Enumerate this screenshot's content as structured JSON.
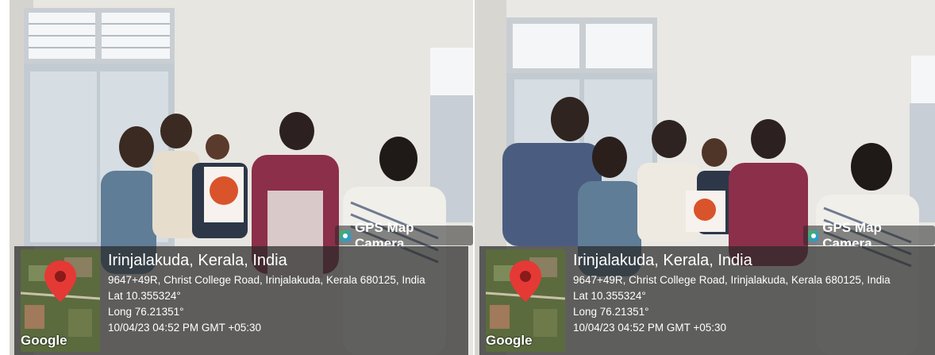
{
  "overlay": {
    "brand": "GPS Map Camera",
    "brand_icon": "gps-camera-icon",
    "place": "Irinjalakuda, Kerala, India",
    "address": "9647+49R, Christ College Road, Irinjalakuda, Kerala 680125, India",
    "lat": "Lat 10.355324°",
    "long": "Long 76.21351°",
    "datetime": "10/04/23 04:52 PM GMT +05:30",
    "map_attribution": "Google"
  },
  "colors": {
    "pin": "#e53935",
    "wall": "#e9e8e4",
    "saree_pink": "#8c2f4a",
    "book_orange": "#d9542b"
  }
}
